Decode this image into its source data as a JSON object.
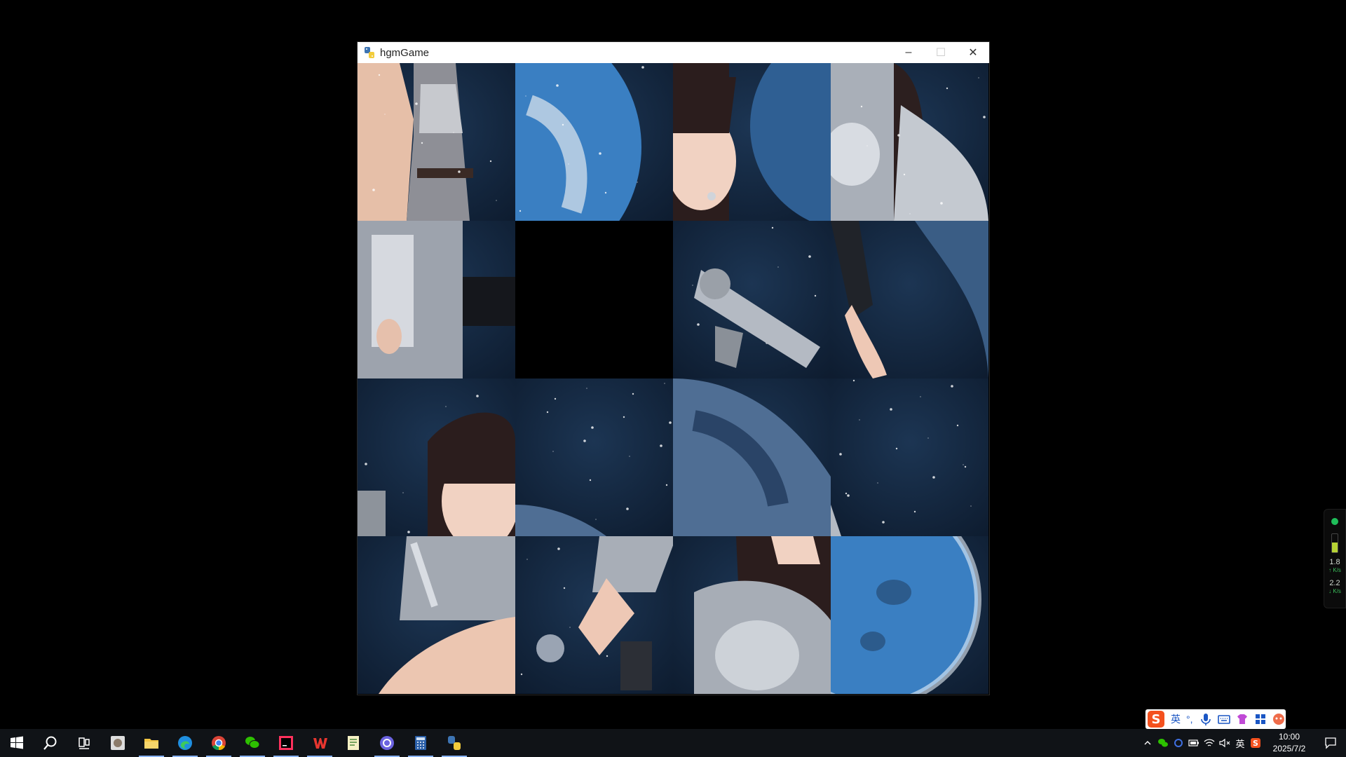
{
  "window": {
    "title": "hgmGame",
    "minimize_label": "–",
    "maximize_label": "☐",
    "close_label": "✕"
  },
  "board": {
    "rows": 4,
    "cols": 4,
    "tiles": [
      {
        "content": "armor-waist-left"
      },
      {
        "content": "planet-edge"
      },
      {
        "content": "face-earring"
      },
      {
        "content": "armor-shoulder"
      },
      {
        "content": "armor-torso"
      },
      {
        "content": "empty"
      },
      {
        "content": "pistol"
      },
      {
        "content": "hand-arm"
      },
      {
        "content": "face-bangs"
      },
      {
        "content": "starfield"
      },
      {
        "content": "planet-surface"
      },
      {
        "content": "starfield-edge"
      },
      {
        "content": "armor-skirt"
      },
      {
        "content": "hand-pistol"
      },
      {
        "content": "armor-chest"
      },
      {
        "content": "planet-moon"
      }
    ]
  },
  "side_widget": {
    "status_color": "#1fbe5a",
    "battery_level": 0.55,
    "upload_speed": "1.8",
    "upload_unit": "↑ K/s",
    "download_speed": "2.2",
    "download_unit": "↓ K/s"
  },
  "ime": {
    "lang_label": "英",
    "punct_label": "°,"
  },
  "taskbar": {
    "apps": [
      {
        "name": "cat-avatar-app",
        "active": false
      },
      {
        "name": "file-explorer",
        "active": true
      },
      {
        "name": "edge",
        "active": true
      },
      {
        "name": "chrome",
        "active": true
      },
      {
        "name": "wechat",
        "active": true
      },
      {
        "name": "intellij",
        "active": true
      },
      {
        "name": "wps",
        "active": true
      },
      {
        "name": "notepad",
        "active": false
      },
      {
        "name": "lens-app",
        "active": true
      },
      {
        "name": "calculator",
        "active": true
      },
      {
        "name": "python-game",
        "active": true
      }
    ],
    "tray": {
      "lang_indicator": "英",
      "time": "10:00",
      "date": "2025/7/2"
    }
  },
  "colors": {
    "space_dark": "#0d1b2e",
    "space_mid": "#1c3553",
    "planet": "#3a7fc2",
    "armor": "#b9bec6"
  }
}
